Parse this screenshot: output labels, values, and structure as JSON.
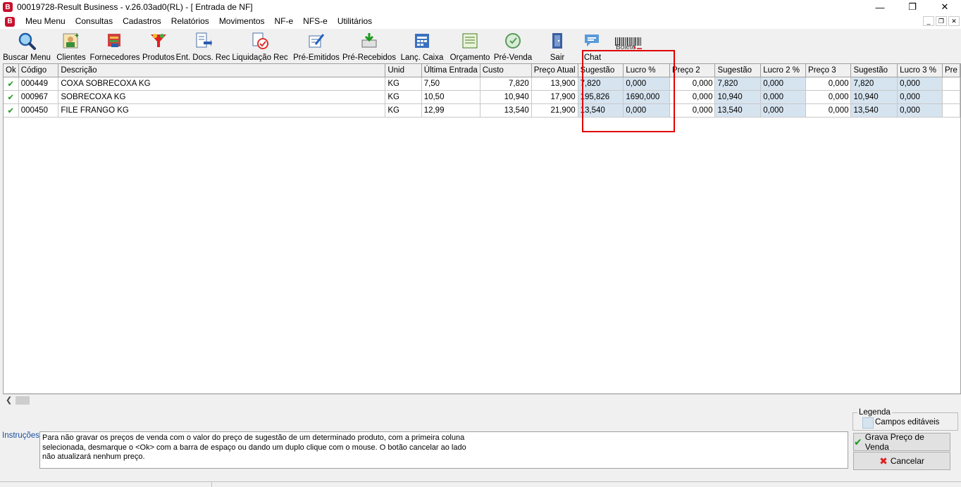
{
  "window": {
    "title": "00019728-Result Business - v.26.03ad0(RL) - [ Entrada de NF]",
    "app_glyph": "B",
    "controls": [
      "—",
      "❐",
      "✕"
    ]
  },
  "menu": [
    "Meu Menu",
    "Consultas",
    "Cadastros",
    "Relatórios",
    "Movimentos",
    "NF-e",
    "NFS-e",
    "Utilitários"
  ],
  "toolbar": [
    {
      "label": "Buscar Menu",
      "icon": "magnifier-icon"
    },
    {
      "label": "Clientes",
      "icon": "clients-icon"
    },
    {
      "label": "Fornecedores",
      "icon": "suppliers-icon"
    },
    {
      "label": "Produtos",
      "icon": "products-icon"
    },
    {
      "label": "Ent. Docs. Rec",
      "icon": "docs-entry-icon"
    },
    {
      "label": "Liquidação Rec",
      "icon": "liquidation-icon"
    },
    {
      "label": "Pré-Emitidos",
      "icon": "pre-issued-icon"
    },
    {
      "label": "Pré-Recebidos",
      "icon": "pre-received-icon"
    },
    {
      "label": "Lanç. Caixa",
      "icon": "cash-entry-icon"
    },
    {
      "label": "Orçamento",
      "icon": "budget-icon"
    },
    {
      "label": "Pré-Venda",
      "icon": "pre-sale-icon"
    },
    {
      "label": "Sair",
      "icon": "exit-door-icon"
    },
    {
      "label": "Chat",
      "icon": "chat-icon"
    },
    {
      "label": "",
      "icon": "boleto-barcode-icon",
      "icon_text": "Boleto"
    }
  ],
  "grid": {
    "columns": [
      "Ok",
      "Código",
      "Descrição",
      "Unid",
      "Última Entrada",
      "Custo",
      "Preço Atual",
      "Sugestão",
      "Lucro %",
      "Preço 2",
      "Sugestão",
      "Lucro 2 %",
      "Preço 3",
      "Sugestão",
      "Lucro 3 %",
      "Pre"
    ],
    "rows": [
      [
        "✔",
        "000449",
        "COXA SOBRECOXA KG",
        "KG",
        "7,50",
        "7,820",
        "13,900",
        "7,820",
        "0,000",
        "0,000",
        "7,820",
        "0,000",
        "0,000",
        "7,820",
        "0,000",
        ""
      ],
      [
        "✔",
        "000967",
        "SOBRECOXA KG",
        "KG",
        "10,50",
        "10,940",
        "17,900",
        "195,826",
        "1690,000",
        "0,000",
        "10,940",
        "0,000",
        "0,000",
        "10,940",
        "0,000",
        ""
      ],
      [
        "✔",
        "000450",
        "FILE FRANGO KG",
        "KG",
        "12,99",
        "13,540",
        "21,900",
        "13,540",
        "0,000",
        "0,000",
        "13,540",
        "0,000",
        "0,000",
        "13,540",
        "0,000",
        ""
      ]
    ]
  },
  "instructions": {
    "label": "Instruções:",
    "lines": [
      "Para não gravar os preços de venda com o valor do preço de sugestão de um determinado produto, com a primeira coluna",
      "selecionada, desmarque o <Ok> com a barra de espaço ou dando um duplo clique com o mouse. O botão cancelar ao lado",
      "não atualizará nenhum preço."
    ]
  },
  "legend": {
    "title": "Legenda",
    "item": "Campos editáveis",
    "swatch_color": "#d6e4f0"
  },
  "buttons": {
    "save": "Grava Preço de Venda",
    "cancel": "Cancelar"
  },
  "colors": {
    "highlight": "#e00000",
    "editable": "#d6e4f0",
    "check": "#1a9a1a"
  }
}
